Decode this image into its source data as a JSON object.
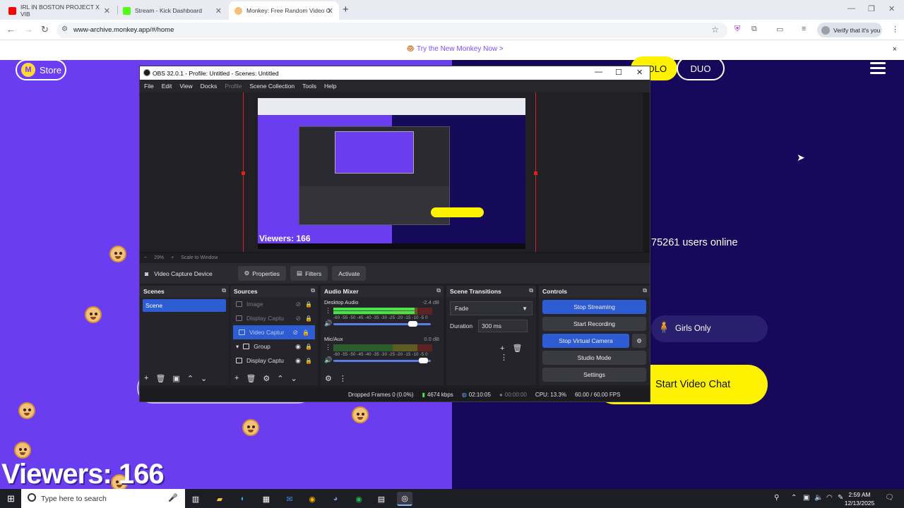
{
  "browser": {
    "tabs": [
      {
        "title": "IRL IN BOSTON PROJECT X VIB",
        "favicon_color": "#ff0000"
      },
      {
        "title": "Stream - Kick Dashboard",
        "favicon_color": "#53fc18"
      },
      {
        "title": "Monkey: Free Random Video C",
        "favicon_color": "#f3c27a"
      }
    ],
    "new_tab": "+",
    "url": "www-archive.monkey.app/#/home",
    "verify_label": "Verify that it's you"
  },
  "banner": {
    "text": "🐵 Try the New Monkey Now >",
    "close": "×"
  },
  "site": {
    "store_label": "Store",
    "store_icon": "M",
    "solo_label": "SOLO",
    "duo_label": "DUO",
    "users_online": "75261 users online",
    "girls_only": "Girls Only",
    "start_chat": "Start Video Chat",
    "viewers_overlay": "Viewers: 166",
    "accent_yellow": "#fff200",
    "left_bg": "#6a3ef0",
    "right_bg": "#16095c"
  },
  "obs": {
    "title": "OBS 32.0.1 - Profile: Untitled - Scenes: Untitled",
    "menu": [
      "File",
      "Edit",
      "View",
      "Docks",
      "Profile",
      "Scene Collection",
      "Tools",
      "Help"
    ],
    "preview_viewers": "Viewers: 166",
    "zoom": "29%",
    "scale_label": "Scale to Window",
    "source_bar": {
      "source_name": "Video Capture Device",
      "properties": "Properties",
      "filters": "Filters",
      "activate": "Activate"
    },
    "scenes": {
      "header": "Scenes",
      "items": [
        "Scene"
      ]
    },
    "sources": {
      "header": "Sources",
      "items": [
        {
          "name": "Image",
          "state": "dim"
        },
        {
          "name": "Display Captu",
          "state": "dim"
        },
        {
          "name": "Video Captur",
          "state": "selected"
        },
        {
          "name": "Group",
          "state": "normal"
        },
        {
          "name": "Display Captu",
          "state": "normal"
        }
      ]
    },
    "mixer": {
      "header": "Audio Mixer",
      "channels": [
        {
          "name": "Desktop Audio",
          "db": "-2.4 dB",
          "level": 0.82,
          "volume": 0.85
        },
        {
          "name": "Mic/Aux",
          "db": "0.0 dB",
          "level": 0.0,
          "volume": 0.97
        }
      ],
      "scale": "-60 -55 -50 -45 -40 -35 -30 -25 -20 -15 -10 -5 0"
    },
    "transitions": {
      "header": "Scene Transitions",
      "type": "Fade",
      "duration_label": "Duration",
      "duration": "300 ms"
    },
    "controls": {
      "header": "Controls",
      "stop_streaming": "Stop Streaming",
      "start_recording": "Start Recording",
      "stop_virtual_camera": "Stop Virtual Camera",
      "studio_mode": "Studio Mode",
      "settings": "Settings"
    },
    "status": {
      "dropped": "Dropped Frames 0 (0.0%)",
      "bitrate": "4674 kbps",
      "stream_time": "02:10:05",
      "rec_time": "00:00:00",
      "cpu": "CPU: 13.3%",
      "fps": "60.00 / 60.00 FPS"
    }
  },
  "taskbar": {
    "search_placeholder": "Type here to search",
    "time": "2:59 AM",
    "date": "12/13/2025"
  }
}
